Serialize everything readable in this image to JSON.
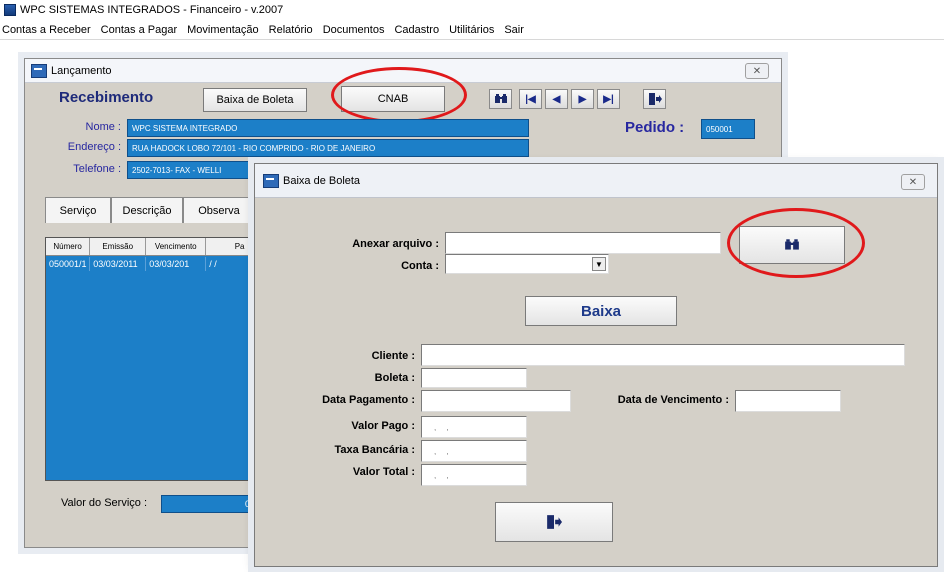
{
  "app": {
    "title": "WPC SISTEMAS INTEGRADOS - Financeiro - v.2007",
    "menu": [
      "Contas a Receber",
      "Contas a Pagar",
      "Movimentação",
      "Relatório",
      "Documentos",
      "Cadastro",
      "Utilitários",
      "Sair"
    ]
  },
  "launch_window": {
    "title": "Lançamento",
    "close_label": "✕",
    "heading": "Recebimento",
    "baixa_button": "Baixa de Boleta",
    "cnab_button": "CNAB",
    "nav_buttons": [
      "|◀",
      "◀",
      "▶",
      "▶|"
    ],
    "pedido_label": "Pedido :",
    "pedido_value": "050001",
    "nome_label": "Nome :",
    "nome_value": "WPC SISTEMA INTEGRADO",
    "endereco_label": "Endereço :",
    "endereco_value": "RUA HADOCK LOBO 72/101 - RIO COMPRIDO - RIO DE JANEIRO",
    "telefone_label": "Telefone :",
    "telefone_value": "2502-7013- FAX - WELLI",
    "tabs": [
      "Serviço",
      "Descrição",
      "Observa"
    ],
    "grid_headers": [
      "Número",
      "Emissão",
      "Vencimento",
      "Pa"
    ],
    "grid_row": [
      "050001/1",
      "03/03/2011",
      "03/03/201",
      "/ /"
    ],
    "valor_label": "Valor do Serviço :",
    "valor_value": "0"
  },
  "dialog": {
    "title": "Baixa de Boleta",
    "close_label": "✕",
    "anexar_label": "Anexar arquivo :",
    "anexar_value": "",
    "conta_label": "Conta :",
    "conta_value": "",
    "baixa_button": "Baixa",
    "cliente_label": "Cliente :",
    "boleta_label": "Boleta :",
    "data_pagamento_label": "Data Pagamento :",
    "data_vencimento_label": "Data de Vencimento :",
    "valor_pago_label": "Valor Pago :",
    "taxa_label": "Taxa Bancária :",
    "valor_total_label": "Valor Total :",
    "placeholder_dots": ", ,"
  },
  "colors": {
    "accent_blue": "#1c7fc8",
    "label_blue": "#2727a0",
    "highlight_red": "#e0191b"
  },
  "icons": [
    "binoculars-icon",
    "exit-door-icon",
    "dropdown-arrow-icon"
  ]
}
